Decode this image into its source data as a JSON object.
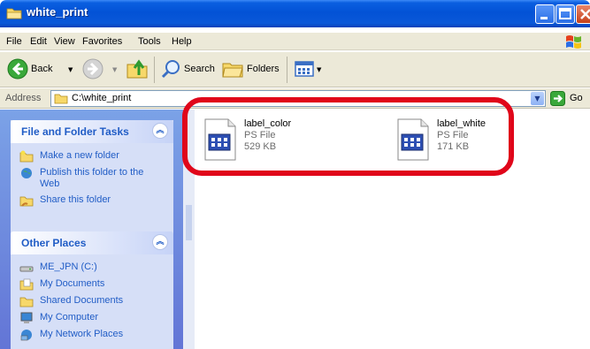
{
  "window": {
    "title": "white_print"
  },
  "menu": {
    "file": "File",
    "edit": "Edit",
    "view": "View",
    "favorites": "Favorites",
    "tools": "Tools",
    "help": "Help"
  },
  "toolbar": {
    "back": "Back",
    "search": "Search",
    "folders": "Folders"
  },
  "address": {
    "label": "Address",
    "value": "C:\\white_print",
    "go": "Go"
  },
  "tasks_panel": {
    "title": "File and Folder Tasks",
    "items": [
      {
        "label": "Make a new folder",
        "icon": "new-folder-icon"
      },
      {
        "label": "Publish this folder to the Web",
        "icon": "publish-web-icon"
      },
      {
        "label": "Share this folder",
        "icon": "share-folder-icon"
      }
    ]
  },
  "places_panel": {
    "title": "Other Places",
    "items": [
      {
        "label": "ME_JPN (C:)",
        "icon": "drive-icon"
      },
      {
        "label": "My Documents",
        "icon": "my-documents-icon"
      },
      {
        "label": "Shared Documents",
        "icon": "shared-documents-icon"
      },
      {
        "label": "My Computer",
        "icon": "my-computer-icon"
      },
      {
        "label": "My Network Places",
        "icon": "network-places-icon"
      }
    ]
  },
  "files": [
    {
      "name": "label_color",
      "type": "PS File",
      "size": "529 KB",
      "icon": "ps-file-icon"
    },
    {
      "name": "label_white",
      "type": "PS File",
      "size": "171 KB",
      "icon": "ps-file-icon"
    }
  ],
  "colors": {
    "titlebar": "#0352d6",
    "highlight": "#e0061a",
    "link": "#215dc6",
    "pane": "#6f8de0"
  }
}
